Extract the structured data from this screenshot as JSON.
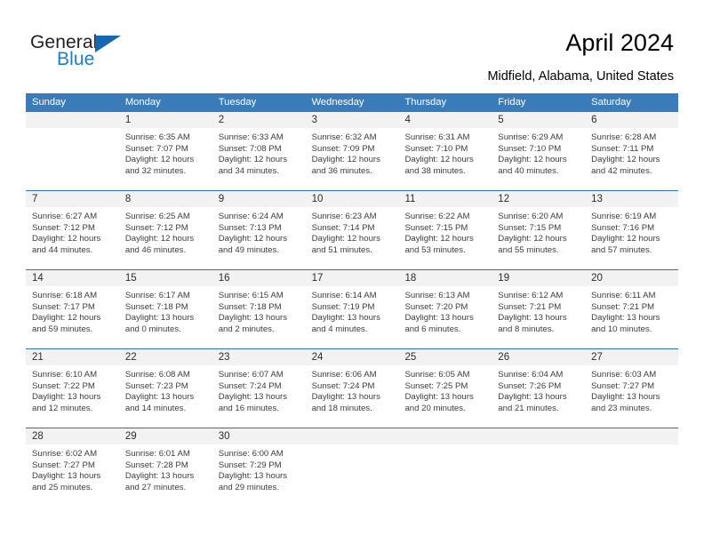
{
  "brand": {
    "name_top": "General",
    "name_bottom": "Blue",
    "triangle_icon": "triangle-icon",
    "accent_color": "#1667b2",
    "text_color": "#231f20"
  },
  "header": {
    "title": "April 2024",
    "location": "Midfield, Alabama, United States"
  },
  "calendar": {
    "header_bg": "#3a7cba",
    "row_divider_color": "#2f6fad",
    "daynum_bg": "#f2f2f2",
    "weekdays": [
      "Sunday",
      "Monday",
      "Tuesday",
      "Wednesday",
      "Thursday",
      "Friday",
      "Saturday"
    ],
    "weeks": [
      [
        {
          "day": "",
          "empty": true,
          "sunrise": "",
          "sunset": "",
          "daylight_line1": "",
          "daylight_line2": ""
        },
        {
          "day": "1",
          "sunrise": "Sunrise: 6:35 AM",
          "sunset": "Sunset: 7:07 PM",
          "daylight_line1": "Daylight: 12 hours",
          "daylight_line2": "and 32 minutes."
        },
        {
          "day": "2",
          "sunrise": "Sunrise: 6:33 AM",
          "sunset": "Sunset: 7:08 PM",
          "daylight_line1": "Daylight: 12 hours",
          "daylight_line2": "and 34 minutes."
        },
        {
          "day": "3",
          "sunrise": "Sunrise: 6:32 AM",
          "sunset": "Sunset: 7:09 PM",
          "daylight_line1": "Daylight: 12 hours",
          "daylight_line2": "and 36 minutes."
        },
        {
          "day": "4",
          "sunrise": "Sunrise: 6:31 AM",
          "sunset": "Sunset: 7:10 PM",
          "daylight_line1": "Daylight: 12 hours",
          "daylight_line2": "and 38 minutes."
        },
        {
          "day": "5",
          "sunrise": "Sunrise: 6:29 AM",
          "sunset": "Sunset: 7:10 PM",
          "daylight_line1": "Daylight: 12 hours",
          "daylight_line2": "and 40 minutes."
        },
        {
          "day": "6",
          "sunrise": "Sunrise: 6:28 AM",
          "sunset": "Sunset: 7:11 PM",
          "daylight_line1": "Daylight: 12 hours",
          "daylight_line2": "and 42 minutes."
        }
      ],
      [
        {
          "day": "7",
          "sunrise": "Sunrise: 6:27 AM",
          "sunset": "Sunset: 7:12 PM",
          "daylight_line1": "Daylight: 12 hours",
          "daylight_line2": "and 44 minutes."
        },
        {
          "day": "8",
          "sunrise": "Sunrise: 6:25 AM",
          "sunset": "Sunset: 7:12 PM",
          "daylight_line1": "Daylight: 12 hours",
          "daylight_line2": "and 46 minutes."
        },
        {
          "day": "9",
          "sunrise": "Sunrise: 6:24 AM",
          "sunset": "Sunset: 7:13 PM",
          "daylight_line1": "Daylight: 12 hours",
          "daylight_line2": "and 49 minutes."
        },
        {
          "day": "10",
          "sunrise": "Sunrise: 6:23 AM",
          "sunset": "Sunset: 7:14 PM",
          "daylight_line1": "Daylight: 12 hours",
          "daylight_line2": "and 51 minutes."
        },
        {
          "day": "11",
          "sunrise": "Sunrise: 6:22 AM",
          "sunset": "Sunset: 7:15 PM",
          "daylight_line1": "Daylight: 12 hours",
          "daylight_line2": "and 53 minutes."
        },
        {
          "day": "12",
          "sunrise": "Sunrise: 6:20 AM",
          "sunset": "Sunset: 7:15 PM",
          "daylight_line1": "Daylight: 12 hours",
          "daylight_line2": "and 55 minutes."
        },
        {
          "day": "13",
          "sunrise": "Sunrise: 6:19 AM",
          "sunset": "Sunset: 7:16 PM",
          "daylight_line1": "Daylight: 12 hours",
          "daylight_line2": "and 57 minutes."
        }
      ],
      [
        {
          "day": "14",
          "sunrise": "Sunrise: 6:18 AM",
          "sunset": "Sunset: 7:17 PM",
          "daylight_line1": "Daylight: 12 hours",
          "daylight_line2": "and 59 minutes."
        },
        {
          "day": "15",
          "sunrise": "Sunrise: 6:17 AM",
          "sunset": "Sunset: 7:18 PM",
          "daylight_line1": "Daylight: 13 hours",
          "daylight_line2": "and 0 minutes."
        },
        {
          "day": "16",
          "sunrise": "Sunrise: 6:15 AM",
          "sunset": "Sunset: 7:18 PM",
          "daylight_line1": "Daylight: 13 hours",
          "daylight_line2": "and 2 minutes."
        },
        {
          "day": "17",
          "sunrise": "Sunrise: 6:14 AM",
          "sunset": "Sunset: 7:19 PM",
          "daylight_line1": "Daylight: 13 hours",
          "daylight_line2": "and 4 minutes."
        },
        {
          "day": "18",
          "sunrise": "Sunrise: 6:13 AM",
          "sunset": "Sunset: 7:20 PM",
          "daylight_line1": "Daylight: 13 hours",
          "daylight_line2": "and 6 minutes."
        },
        {
          "day": "19",
          "sunrise": "Sunrise: 6:12 AM",
          "sunset": "Sunset: 7:21 PM",
          "daylight_line1": "Daylight: 13 hours",
          "daylight_line2": "and 8 minutes."
        },
        {
          "day": "20",
          "sunrise": "Sunrise: 6:11 AM",
          "sunset": "Sunset: 7:21 PM",
          "daylight_line1": "Daylight: 13 hours",
          "daylight_line2": "and 10 minutes."
        }
      ],
      [
        {
          "day": "21",
          "sunrise": "Sunrise: 6:10 AM",
          "sunset": "Sunset: 7:22 PM",
          "daylight_line1": "Daylight: 13 hours",
          "daylight_line2": "and 12 minutes."
        },
        {
          "day": "22",
          "sunrise": "Sunrise: 6:08 AM",
          "sunset": "Sunset: 7:23 PM",
          "daylight_line1": "Daylight: 13 hours",
          "daylight_line2": "and 14 minutes."
        },
        {
          "day": "23",
          "sunrise": "Sunrise: 6:07 AM",
          "sunset": "Sunset: 7:24 PM",
          "daylight_line1": "Daylight: 13 hours",
          "daylight_line2": "and 16 minutes."
        },
        {
          "day": "24",
          "sunrise": "Sunrise: 6:06 AM",
          "sunset": "Sunset: 7:24 PM",
          "daylight_line1": "Daylight: 13 hours",
          "daylight_line2": "and 18 minutes."
        },
        {
          "day": "25",
          "sunrise": "Sunrise: 6:05 AM",
          "sunset": "Sunset: 7:25 PM",
          "daylight_line1": "Daylight: 13 hours",
          "daylight_line2": "and 20 minutes."
        },
        {
          "day": "26",
          "sunrise": "Sunrise: 6:04 AM",
          "sunset": "Sunset: 7:26 PM",
          "daylight_line1": "Daylight: 13 hours",
          "daylight_line2": "and 21 minutes."
        },
        {
          "day": "27",
          "sunrise": "Sunrise: 6:03 AM",
          "sunset": "Sunset: 7:27 PM",
          "daylight_line1": "Daylight: 13 hours",
          "daylight_line2": "and 23 minutes."
        }
      ],
      [
        {
          "day": "28",
          "sunrise": "Sunrise: 6:02 AM",
          "sunset": "Sunset: 7:27 PM",
          "daylight_line1": "Daylight: 13 hours",
          "daylight_line2": "and 25 minutes."
        },
        {
          "day": "29",
          "sunrise": "Sunrise: 6:01 AM",
          "sunset": "Sunset: 7:28 PM",
          "daylight_line1": "Daylight: 13 hours",
          "daylight_line2": "and 27 minutes."
        },
        {
          "day": "30",
          "sunrise": "Sunrise: 6:00 AM",
          "sunset": "Sunset: 7:29 PM",
          "daylight_line1": "Daylight: 13 hours",
          "daylight_line2": "and 29 minutes."
        },
        {
          "day": "",
          "empty": true,
          "sunrise": "",
          "sunset": "",
          "daylight_line1": "",
          "daylight_line2": ""
        },
        {
          "day": "",
          "empty": true,
          "sunrise": "",
          "sunset": "",
          "daylight_line1": "",
          "daylight_line2": ""
        },
        {
          "day": "",
          "empty": true,
          "sunrise": "",
          "sunset": "",
          "daylight_line1": "",
          "daylight_line2": ""
        },
        {
          "day": "",
          "empty": true,
          "sunrise": "",
          "sunset": "",
          "daylight_line1": "",
          "daylight_line2": ""
        }
      ]
    ]
  }
}
